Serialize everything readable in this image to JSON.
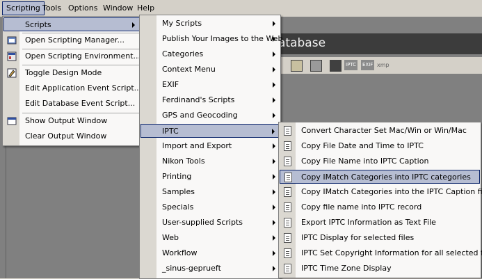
{
  "menubar": {
    "items": [
      "Scripting",
      "Tools",
      "Options",
      "Window",
      "Help"
    ]
  },
  "app": {
    "title_fragment": "atabase",
    "toolbar_labels": [
      "IPTC",
      "EXIF",
      "xmp"
    ]
  },
  "scripting_menu": {
    "items": [
      {
        "label": "Scripts",
        "submenu": true
      },
      {
        "label": "Open Scripting Manager..."
      },
      {
        "label": "Open Scripting Environment..."
      },
      {
        "label": "Toggle Design Mode"
      },
      {
        "label": "Edit Application Event Script..."
      },
      {
        "label": "Edit Database Event Script..."
      },
      {
        "label": "Show Output Window"
      },
      {
        "label": "Clear Output Window"
      }
    ]
  },
  "scripts_menu": {
    "items": [
      "My Scripts",
      "Publish Your Images to the Web",
      "Categories",
      "Context Menu",
      "EXIF",
      "Ferdinand's Scripts",
      "GPS and Geocoding",
      "IPTC",
      "Import and Export",
      "Nikon Tools",
      "Printing",
      "Samples",
      "Specials",
      "User-supplied Scripts",
      "Web",
      "Workflow",
      "_sinus-geprueft"
    ]
  },
  "iptc_menu": {
    "items": [
      "Convert Character Set Mac/Win or Win/Mac",
      "Copy File Date and Time to IPTC",
      "Copy File Name into IPTC Caption",
      "Copy IMatch Categories into IPTC categories",
      "Copy IMatch Categories into the IPTC Caption field",
      "Copy file name into IPTC record",
      "Export IPTC Information as Text File",
      "IPTC Display for selected files",
      "IPTC Set Copyright Information for all selected files",
      "IPTC Time Zone Display"
    ]
  },
  "colors": {
    "highlight_bg": "#b6bdd2",
    "highlight_border": "#0a246a",
    "menu_bg": "#f9f8f7",
    "gutter": "#dbd8d1"
  }
}
